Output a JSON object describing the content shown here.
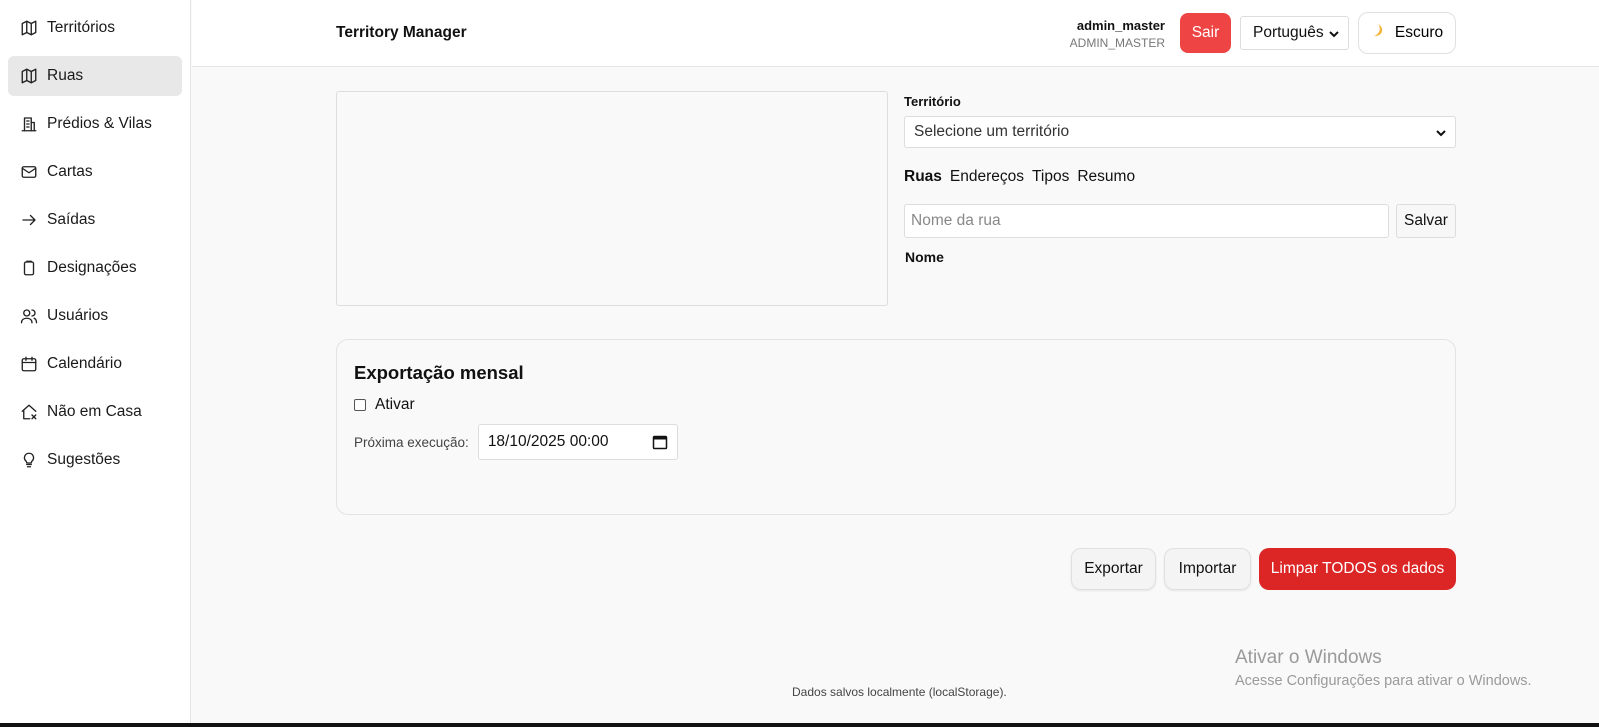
{
  "sidebar": {
    "items": [
      {
        "label": "Territórios",
        "icon": "map-icon"
      },
      {
        "label": "Ruas",
        "icon": "map-icon",
        "active": true
      },
      {
        "label": "Prédios & Vilas",
        "icon": "building-icon"
      },
      {
        "label": "Cartas",
        "icon": "mail-icon"
      },
      {
        "label": "Saídas",
        "icon": "arrow-right-icon"
      },
      {
        "label": "Designações",
        "icon": "clipboard-icon"
      },
      {
        "label": "Usuários",
        "icon": "users-icon"
      },
      {
        "label": "Calendário",
        "icon": "calendar-icon"
      },
      {
        "label": "Não em Casa",
        "icon": "house-x-icon"
      },
      {
        "label": "Sugestões",
        "icon": "lightbulb-icon"
      }
    ]
  },
  "header": {
    "title": "Territory Manager",
    "user_name": "admin_master",
    "user_role": "ADMIN_MASTER",
    "logout_label": "Sair",
    "language_selected": "Português",
    "theme_label": "Escuro",
    "theme_icon": "moon-icon"
  },
  "territory": {
    "label": "Território",
    "select_placeholder": "Selecione um território"
  },
  "tabs": [
    "Ruas",
    "Endereços",
    "Tipos",
    "Resumo"
  ],
  "street_form": {
    "placeholder": "Nome da rua",
    "save_label": "Salvar",
    "column_name": "Nome"
  },
  "monthly_export": {
    "title": "Exportação mensal",
    "enable_label": "Ativar",
    "next_run_label": "Próxima execução:",
    "next_run_value": "18/10/2025 00:00"
  },
  "actions": {
    "export_label": "Exportar",
    "import_label": "Importar",
    "clear_label": "Limpar TODOS os dados"
  },
  "footer": {
    "text": "Dados salvos localmente (localStorage)."
  },
  "watermark": {
    "title": "Ativar o Windows",
    "subtitle": "Acesse Configurações para ativar o Windows."
  },
  "colors": {
    "danger": "#dc2626",
    "logout": "#ef4444",
    "active_nav": "#e8e8e8"
  }
}
